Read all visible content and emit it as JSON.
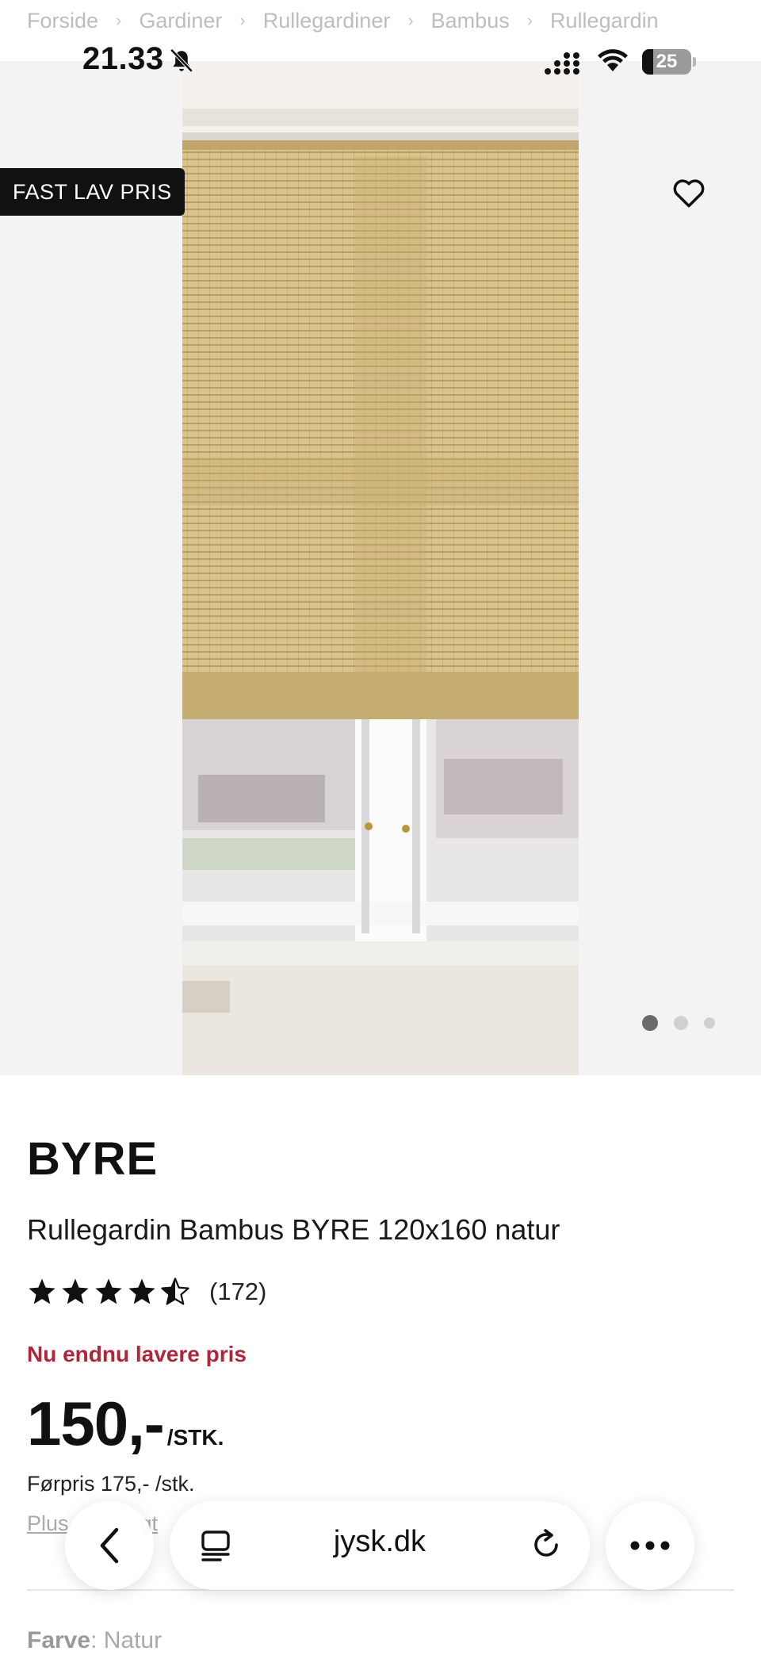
{
  "breadcrumb": [
    "Forside",
    "Gardiner",
    "Rullegardiner",
    "Bambus",
    "Rullegardin"
  ],
  "status": {
    "time": "21.33",
    "battery": "25"
  },
  "product": {
    "badge": "FAST LAV PRIS",
    "brand": "BYRE",
    "name": "Rullegardin Bambus BYRE 120x160 natur",
    "rating": {
      "stars": 4.5,
      "count": "(172)"
    },
    "promo": "Nu endnu lavere pris",
    "price": "150,-",
    "price_unit": "/STK.",
    "previous_price": "Førpris 175,- /stk.",
    "plus_link": "Plus",
    "plus_link_tail": "gt",
    "color_label": "Farve",
    "color_value": ": Natur",
    "gallery": {
      "count": 3,
      "active": 1
    }
  },
  "browser": {
    "domain": "jysk.dk"
  },
  "colors": {
    "promo": "#b0253a",
    "badge": "#111111"
  },
  "icons": [
    "bell-off-icon",
    "signal-icon",
    "wifi-icon",
    "battery-icon",
    "heart-icon",
    "star-icon",
    "back-icon",
    "reader-icon",
    "reload-icon",
    "more-icon"
  ]
}
